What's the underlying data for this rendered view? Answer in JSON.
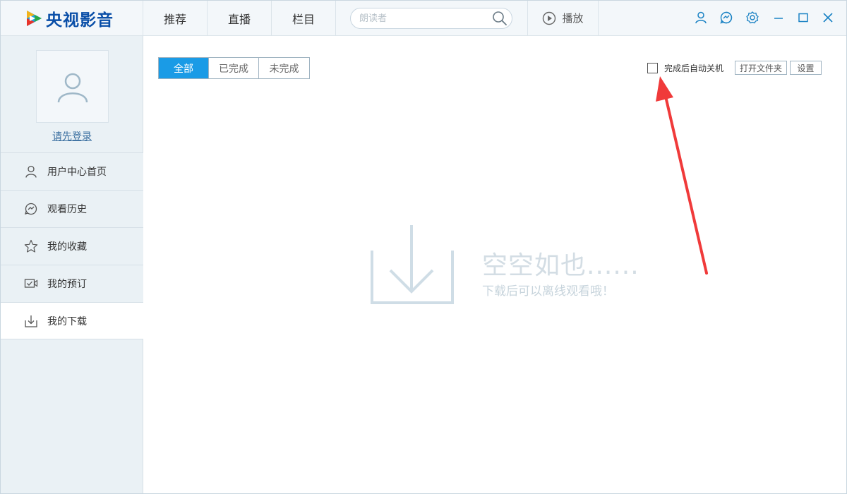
{
  "app": {
    "title": "央视影音",
    "brand_color": "#0a4fa8",
    "accent_color": "#1a9be6"
  },
  "header": {
    "nav": [
      {
        "label": "推荐"
      },
      {
        "label": "直播"
      },
      {
        "label": "栏目"
      }
    ],
    "search": {
      "placeholder": "朗读者",
      "value": "",
      "icon": "search-icon"
    },
    "play": {
      "label": "播放",
      "icon": "play-circle-icon"
    },
    "window_icons": [
      "user-icon",
      "history-icon",
      "gear-icon",
      "minimize-icon",
      "maximize-icon",
      "close-icon"
    ]
  },
  "sidebar": {
    "avatar_icon": "user-placeholder-icon",
    "login_label": "请先登录",
    "items": [
      {
        "label": "用户中心首页",
        "icon": "user-icon"
      },
      {
        "label": "观看历史",
        "icon": "history-icon"
      },
      {
        "label": "我的收藏",
        "icon": "star-icon"
      },
      {
        "label": "我的预订",
        "icon": "reservation-icon"
      },
      {
        "label": "我的下载",
        "icon": "download-icon",
        "active": true
      }
    ]
  },
  "main": {
    "filters": [
      {
        "label": "全部",
        "active": true
      },
      {
        "label": "已完成",
        "active": false
      },
      {
        "label": "未完成",
        "active": false
      }
    ],
    "auto_shutdown": {
      "label": "完成后自动关机",
      "checked": false
    },
    "open_folder_label": "打开文件夹",
    "settings_label": "设置",
    "empty": {
      "icon": "download-tray-icon",
      "title": "空空如也......",
      "subtitle": "下载后可以离线观看哦！"
    },
    "annotation": {
      "color": "#f03a3a",
      "icon": "red-arrow-annotation"
    }
  }
}
